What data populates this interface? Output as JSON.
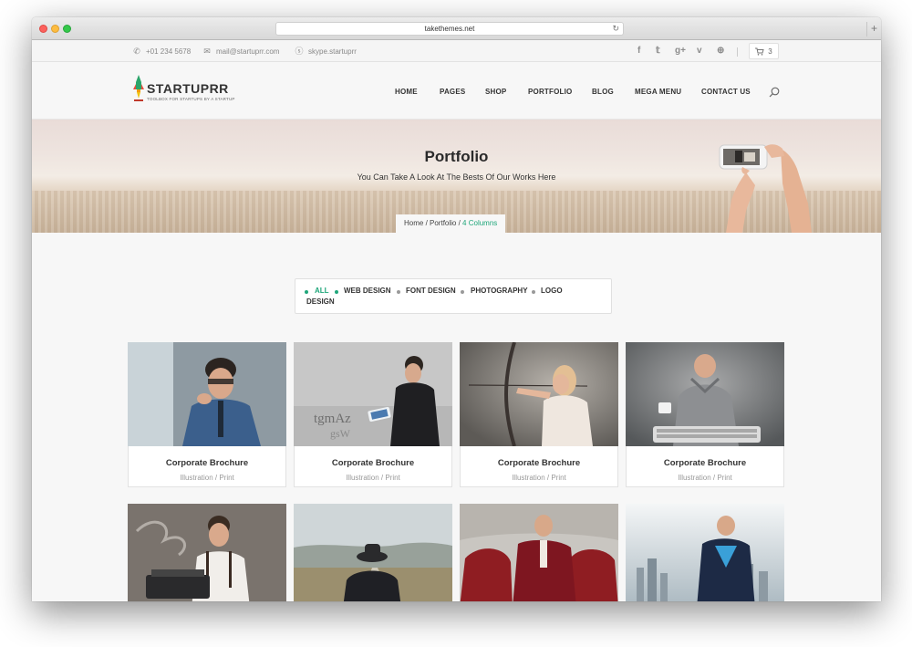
{
  "browser": {
    "url": "takethemes.net",
    "new_tab": "+",
    "reload_icon": "reload-icon"
  },
  "topbar": {
    "phone": "+01 234 5678",
    "email": "mail@startuprr.com",
    "skype": "skype.startuprr",
    "social_icons": [
      "facebook-icon",
      "twitter-icon",
      "google-plus-icon",
      "vimeo-icon",
      "dribbble-icon"
    ],
    "social_glyphs": [
      "f",
      "𝕥",
      "g+",
      "v",
      "⊕"
    ],
    "cart_count": "3"
  },
  "header": {
    "logo_name": "STARTUPRR",
    "logo_tagline": "TOOLBOX FOR STARTUPS BY A STARTUP",
    "nav": [
      "HOME",
      "PAGES",
      "SHOP",
      "PORTFOLIO",
      "BLOG",
      "MEGA MENU",
      "CONTACT US"
    ]
  },
  "hero": {
    "title": "Portfolio",
    "subtitle": "You Can Take A Look At The Bests Of Our Works Here",
    "breadcrumb": {
      "home": "Home",
      "sep1": " / ",
      "section": "Portfolio",
      "sep2": " / ",
      "current": "4 Columns"
    }
  },
  "filters": [
    "ALL",
    "WEB DESIGN",
    "FONT DESIGN",
    "PHOTOGRAPHY",
    "LOGO",
    "DESIGN"
  ],
  "portfolio": [
    {
      "title": "Corporate Brochure",
      "category": "Illustration / Print"
    },
    {
      "title": "Corporate Brochure",
      "category": "Illustration / Print"
    },
    {
      "title": "Corporate Brochure",
      "category": "Illustration / Print"
    },
    {
      "title": "Corporate Brochure",
      "category": "Illustration / Print"
    }
  ],
  "colors": {
    "accent": "#1fa67a",
    "text": "#333333",
    "muted": "#999999",
    "background": "#f7f7f7"
  }
}
